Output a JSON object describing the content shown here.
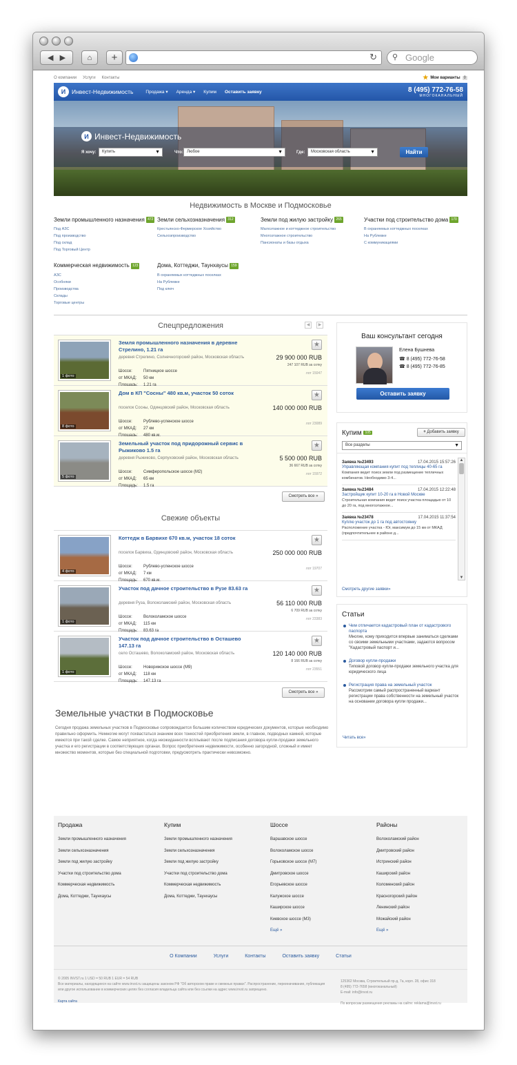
{
  "browser": {
    "search_placeholder": "Google"
  },
  "topnav": {
    "links": [
      "О компании",
      "Услуги",
      "Контакты"
    ],
    "favorites_label": "Мои варианты",
    "favorites_count": "0"
  },
  "header": {
    "brand": "Инвест-Недвижимость",
    "menu": [
      "Продажа",
      "Аренда",
      "Купим",
      "Оставить заявку"
    ],
    "phone": "8 (495) 772-76-58",
    "phone_caption": "МНОГОКАНАЛЬНЫЙ"
  },
  "hero": {
    "title": "Инвест-Недвижимость",
    "want_label": "Я хочу:",
    "want_value": "Купить",
    "what_label": "Что:",
    "what_value": "Любое",
    "where_label": "Где:",
    "where_value": "Московская область",
    "find_button": "Найти"
  },
  "categories": {
    "title": "Недвижимость в Москве и Подмосковье",
    "items": [
      {
        "name": "Земли промышленного назначения",
        "count": "472",
        "links": [
          "Под АЗС",
          "Под производство",
          "Под склад",
          "Под Торговый Центр"
        ]
      },
      {
        "name": "Земли сельхозназначения",
        "count": "312",
        "links": [
          "Крестьянско-Фермерское Хозяйство",
          "Сельхозпроизводство"
        ]
      },
      {
        "name": "Земли под жилую застройку",
        "count": "265",
        "links": [
          "Малоэтажное и коттеджное строительство",
          "Многоэтажное строительство",
          "Пансионаты и базы отдыха"
        ]
      },
      {
        "name": "Участки под строительство дома",
        "count": "170",
        "links": [
          "В охраняемых коттеджных поселках",
          "На Рублевке",
          "С коммуникациями"
        ]
      },
      {
        "name": "Коммерческая недвижимость",
        "count": "123",
        "links": [
          "АЗС",
          "Особняки",
          "Производства",
          "Склады",
          "Торговые центры"
        ]
      },
      {
        "name": "Дома, Коттеджи, Таунхаусы",
        "count": "159",
        "links": [
          "В охраняемых коттеджных поселках",
          "На Рублевке",
          "Под ключ"
        ]
      }
    ]
  },
  "special": {
    "title": "Спецпредложения",
    "more_button": "Смотреть все »",
    "items": [
      {
        "title": "Земля промышленного назначения в деревне Стрелино, 1.21 га",
        "location": "деревня Стрелино, Солнечногорский район, Московская область",
        "props": [
          [
            "Шоссе:",
            "Пятницкое шоссе"
          ],
          [
            "от МКАД:",
            "50 км"
          ],
          [
            "Площадь:",
            "1.21 га"
          ]
        ],
        "price": "29 900 000 RUB",
        "sqm": "247 107 RUB за сотку",
        "lot": "лот 15047",
        "photos": "1 фото"
      },
      {
        "title": "Дом в КП \"Сосны\" 480 кв.м, участок 50 соток",
        "location": "поселок Сосны, Одинцовский район, Московская область",
        "props": [
          [
            "Шоссе:",
            "Рублево-успенское шоссе"
          ],
          [
            "от МКАД:",
            "27 км"
          ],
          [
            "Площадь:",
            "480 кв.м."
          ]
        ],
        "price": "140 000 000 RUB",
        "sqm": "",
        "lot": "лот 23089",
        "photos": "8 фото"
      },
      {
        "title": "Земельный участок под придорожный сервис в Рыжиково 1.5 га",
        "location": "деревня Рыжиково, Серпуховский район, Московская область",
        "props": [
          [
            "Шоссе:",
            "Симферопольское шоссе (М2)"
          ],
          [
            "от МКАД:",
            "65 км"
          ],
          [
            "Площадь:",
            "1.5 га"
          ]
        ],
        "price": "5 500 000 RUB",
        "sqm": "36 667 RUB за сотку",
        "lot": "лот 15972",
        "photos": "5 фото"
      }
    ]
  },
  "fresh": {
    "title": "Свежие объекты",
    "more_button": "Смотреть все »",
    "items": [
      {
        "title": "Коттедж в Барвихе 670 кв.м, участок 18 соток",
        "location": "поселок Барвиха, Одинцовский район, Московская область",
        "props": [
          [
            "Шоссе:",
            "Рублево-успенское шоссе"
          ],
          [
            "от МКАД:",
            "7 км"
          ],
          [
            "Площадь:",
            "670 кв.м."
          ]
        ],
        "price": "250 000 000 RUB",
        "sqm": "",
        "lot": "лот 19707",
        "photos": "4 фото"
      },
      {
        "title": "Участок под дачное строительство в Рузе 83.63 га",
        "location": "деревня Руза, Волоколамский район, Московская область",
        "props": [
          [
            "Шоссе:",
            "Волоколамское шоссе"
          ],
          [
            "от МКАД:",
            "115 км"
          ],
          [
            "Площадь:",
            "83.63 га"
          ]
        ],
        "price": "56 110 000 RUB",
        "sqm": "6 709 RUB за сотку",
        "lot": "лот 23383",
        "photos": "1 фото"
      },
      {
        "title": "Участок под дачное строительство в Осташево 147.13 га",
        "location": "село Осташево, Волоколамский район, Московская область",
        "props": [
          [
            "Шоссе:",
            "Новорижское шоссе (М9)"
          ],
          [
            "от МКАД:",
            "118 км"
          ],
          [
            "Площадь:",
            "147.13 га"
          ]
        ],
        "price": "120 140 000 RUB",
        "sqm": "8 166 RUB за сотку",
        "lot": "лот 23551",
        "photos": "1 фото"
      }
    ]
  },
  "consultant": {
    "title": "Ваш консультант сегодня",
    "name": "Елена Бушнева",
    "phone1": "8 (495) 772-76-58",
    "phone2": "8 (495) 772-76-85",
    "button": "Оставить заявку"
  },
  "buy": {
    "title": "Купим",
    "count": "105",
    "add_button": "Добавить заявку",
    "filter": "Все разделы",
    "more_link": "Смотреть другие заявки»",
    "items": [
      {
        "id": "Заявка №23493",
        "date": "17.04.2015 15:57:26",
        "title": "Управляющая компания купит под теплицы 40-65 га",
        "text": "Компания ведет поиск земли под размещение тепличных комбинатов. Необходимо 3-4..."
      },
      {
        "id": "Заявка №23484",
        "date": "17.04.2015 12:22:48",
        "title": "Застройщик купит 10-20 га в Новой Москве",
        "text": "Строительная компания ведет поиск участка площадью от 10 до 20 га, под многоэтажное..."
      },
      {
        "id": "Заявка №23478",
        "date": "17.04.2015 11:37:54",
        "title": "Куплю участок до 1 га под автостоянку",
        "text": "Расположение участка - Юг, максимум до 15 км от МКАД (предпочтительнее в районе д..."
      }
    ]
  },
  "articles": {
    "title": "Статьи",
    "more_link": "Читать все»",
    "items": [
      {
        "title": "Чем отличается кадастровый план от кадастрового паспорта",
        "text": "Многие, кому приходится впервые заниматься сделками со своими земельными участками, задаются вопросом \"Кадастровый паспорт и..."
      },
      {
        "title": "Договор купли-продажи",
        "text": "Типовой договор купли-продажи земельного участка для юридического лица"
      },
      {
        "title": "Регистрация права на земельный участок",
        "text": "Рассмотрим самый распространенный вариант регистрации права собственности на земельный участок на основании договора купли продажи..."
      }
    ]
  },
  "seo": {
    "title": "Земельные участки в Подмосковье",
    "text": "Сегодня продажа земельных участков в Подмосковье сопровождается большим количеством юридических документов, которые необходимо правильно оформить. Немногие могут похвастаться знанием всех тонкостей приобретения земли, в главное, подводных камней, которые имеются при такой сделке. Самое неприятное, когда неожиданности всплывают после подписания договора купли-продажи земельного участка и его регистрации в соответствующих органах. Вопрос приобретения недвижимости, особенно загородной, сложный и имеет множество моментов, которые без специальной подготовки, предусмотреть практически невозможно."
  },
  "footer": {
    "columns": [
      {
        "title": "Продажа",
        "links": [
          "Земли промышленного назначения",
          "Земли сельхозназначения",
          "Земли под жилую застройку",
          "Участки под строительство дома",
          "Коммерческая недвижимость",
          "Дома, Коттеджи, Таунхаусы"
        ]
      },
      {
        "title": "Купим",
        "links": [
          "Земли промышленного назначения",
          "Земли сельхозназначения",
          "Земли под жилую застройку",
          "Участки под строительство дома",
          "Коммерческая недвижимость",
          "Дома, Коттеджи, Таунхаусы"
        ]
      },
      {
        "title": "Шоссе",
        "links": [
          "Варшавское шоссе",
          "Волоколамское шоссе",
          "Горьковское шоссе (М7)",
          "Дмитровское шоссе",
          "Егорьевское шоссе",
          "Калужское шоссе",
          "Каширское шоссе",
          "Киевское шоссе (М3)",
          "Ещё »"
        ]
      },
      {
        "title": "Районы",
        "links": [
          "Волоколамский район",
          "Дмитровский район",
          "Истринский район",
          "Каширский район",
          "Коломенский район",
          "Красногорский район",
          "Ленинский район",
          "Можайский район",
          "Ещё »"
        ]
      }
    ],
    "links": [
      "О Компании",
      "Услуги",
      "Контакты",
      "Оставить заявку",
      "Статьи"
    ],
    "copyright": "© 2005 INVST.ru    1 USD = 50 RUB    1 EUR = 54 RUB",
    "legal": "Все материалы, находящиеся на сайте www.invst.ru защищены законом РФ \"Об авторском праве и смежных правах\". Распространение, переиначивание, публикация или другое использование в коммерческих целях без согласия владельца сайта или без ссылки на адрес www.invst.ru запрещено.",
    "sitemap": "Карта сайта",
    "address": "125362 Москва, Строительный пр-д, 7а, корп. 28, офис 318",
    "phone": "8 (495) 772-7658 (многоканальный)",
    "email": "E-mail: info@invst.ru",
    "ads": "По вопросам размещения рекламы на сайте: reklama@invst.ru"
  }
}
